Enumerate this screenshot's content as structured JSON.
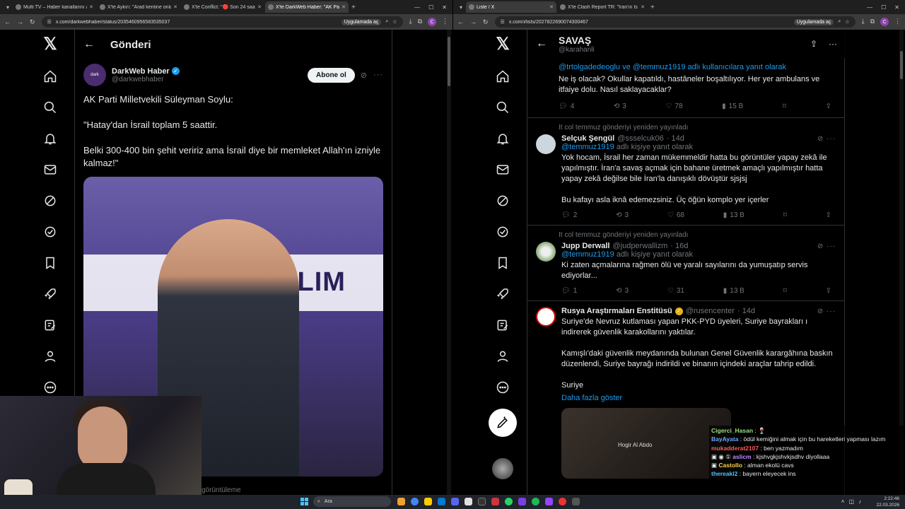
{
  "left": {
    "tabs": [
      {
        "title": "Multi TV – Haber kanallarını ay"
      },
      {
        "title": "X'te Aykırı: \"Arad kentine onlar"
      },
      {
        "title": "X'te Conflict: \"🔴 Son 24 saatte"
      },
      {
        "title": "X'te DarkWeb Haber: \"AK Parti"
      }
    ],
    "url": "x.com/darkwebhaber/status/2035460956583535037",
    "app_pill": "Uygulamada aç",
    "header_title": "Gönderi",
    "author_name": "DarkWeb Haber",
    "author_handle": "@darkwebhaber",
    "avatar_text": "dark",
    "follow_label": "Abone ol",
    "post_text": "AK Parti Milletvekili Süleyman Soylu:\n\n\"Hatay'dan İsrail toplam 5 saattir.\n\nBelki 300-400 bin şehit veririz ama İsrail diye bir memleket Allah'ın izniyle kalmaz!\"",
    "photo_banner": "ÜYE KATILIM TÖRENİ",
    "views_partial": "görüntüleme"
  },
  "right": {
    "tabs": [
      {
        "title": "Liste / X"
      },
      {
        "title": "X'te Clash Report TR: \"İran'ın İs"
      }
    ],
    "url": "x.com/i/lists/2027822690074300467",
    "app_pill": "Uygulamada aç",
    "list_title": "SAVAŞ",
    "list_sub": "@karahanli",
    "partial_tweet": {
      "reply_to": "@trtolgadedeoglu ve @temmuz1919 adlı kullanıcılara yanıt olarak",
      "text": "Ne iş olacak? Okullar kapatıldı, hastâneler boşaltılıyor. Her yer ambulans ve itfaiye dolu. Nasıl saklayacaklar?",
      "replies": "4",
      "reposts": "3",
      "likes": "78",
      "views": "15 B"
    },
    "tweets": [
      {
        "repost_note": "It col temmuz gönderiyi yeniden yayınladı",
        "name": "Selçuk Şengül",
        "handle": "@ssselcuk06",
        "time": "· 14d",
        "reply_mention": "@temmuz1919",
        "reply_suffix": " adlı kişiye yanıt olarak",
        "text": "Yok hocam, İsrail her zaman mükemmeldir hatta bu görüntüler yapay zekâ ile yapılmıştır. İran'a savaş açmak için bahane üretmek amaçlı yapılmıştır hatta yapay zekâ değilse bile İran'la danışıklı dövüştür sjsjsj\n\nBu kafayı asla iknâ edemezsiniz. Üç öğün komplo yer içerler",
        "replies": "2",
        "reposts": "3",
        "likes": "68",
        "views": "13 B"
      },
      {
        "repost_note": "It col temmuz gönderiyi yeniden yayınladı",
        "name": "Jupp Derwall",
        "handle": "@judperwallizm",
        "time": "· 16d",
        "reply_mention": "@temmuz1919",
        "reply_suffix": " adlı kişiye yanıt olarak",
        "text": "Ki zaten açmalarına rağmen ölü ve yaralı sayılarını da yumuşatıp servis ediyorlar...",
        "replies": "1",
        "reposts": "3",
        "likes": "31",
        "views": "13 B"
      },
      {
        "name": "Rusya Araştırmaları Enstitüsü",
        "handle": "@rusencenter",
        "time": "· 14d",
        "text": "Suriye'de Nevruz kutlaması yapan PKK-PYD üyeleri, Suriye bayrakları ı indirerek güvenlik karakollarını yaktılar.\n\nKamışlı'daki güvenlik meydanında bulunan Genel Güvenlik karargâhına baskın düzenlendi, Suriye bayrağı indirildi ve binanın içindeki araçlar tahrip edildi.\n\nSuriye",
        "show_more": "Daha fazla göster",
        "media_caption": "Hogir Al Abdo"
      }
    ]
  },
  "chat": [
    {
      "user": "Cigerci_Hasan",
      "color": "#9be07a",
      "msg": " : 🍷"
    },
    {
      "user": "BayAyata",
      "color": "#6aa5ff",
      "msg": " : ödül kemiğini almak için bu hareketleri yapması lazım"
    },
    {
      "user": "mukadderat2107",
      "color": "#ff5a5a",
      "msg": " : ben yazmadım"
    },
    {
      "user": "aslicm",
      "color": "#c08cff",
      "msg": " : kjshvgkjshvkjsdhv diyollaaa"
    },
    {
      "user": "Castollo",
      "color": "#ffd24a",
      "msg": " : alman ekolü cavs"
    },
    {
      "user": "thereakl2",
      "color": "#4ec3ff",
      "msg": " : bayern eleyecek ins"
    }
  ],
  "taskbar": {
    "search_placeholder": "Ara",
    "time": "2:22:46",
    "date": "22.03.2026"
  }
}
